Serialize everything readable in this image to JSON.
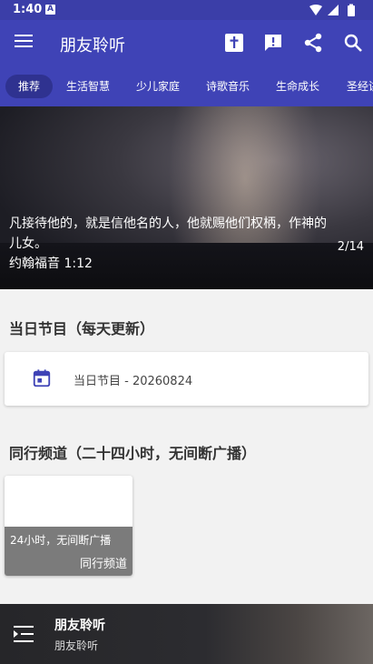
{
  "status": {
    "time": "1:40",
    "notif": "A"
  },
  "app_bar": {
    "title": "朋友聆听"
  },
  "tabs": [
    {
      "label": "推荐",
      "active": true
    },
    {
      "label": "生活智慧",
      "active": false
    },
    {
      "label": "少儿家庭",
      "active": false
    },
    {
      "label": "诗歌音乐",
      "active": false
    },
    {
      "label": "生命成长",
      "active": false
    },
    {
      "label": "圣经讲",
      "active": false
    }
  ],
  "hero": {
    "verse": "凡接待他的，就是信他名的人，他就赐他们权柄，作神的儿女。",
    "reference": "约翰福音 1:12",
    "counter": "2/14"
  },
  "daily": {
    "section_title": "当日节目（每天更新）",
    "card_label": "当日节目 - 20260824"
  },
  "channels": {
    "section_title": "同行频道（二十四小时，无间断广播）",
    "card_desc": "24小时，无间断广播",
    "card_name": "同行频道"
  },
  "player": {
    "title": "朋友聆听",
    "subtitle": "朋友聆听"
  },
  "colors": {
    "primary": "#3f43b6",
    "status_bar": "#3b3ea8",
    "tab_active": "#2f3290",
    "calendar_icon": "#3f43b6"
  }
}
